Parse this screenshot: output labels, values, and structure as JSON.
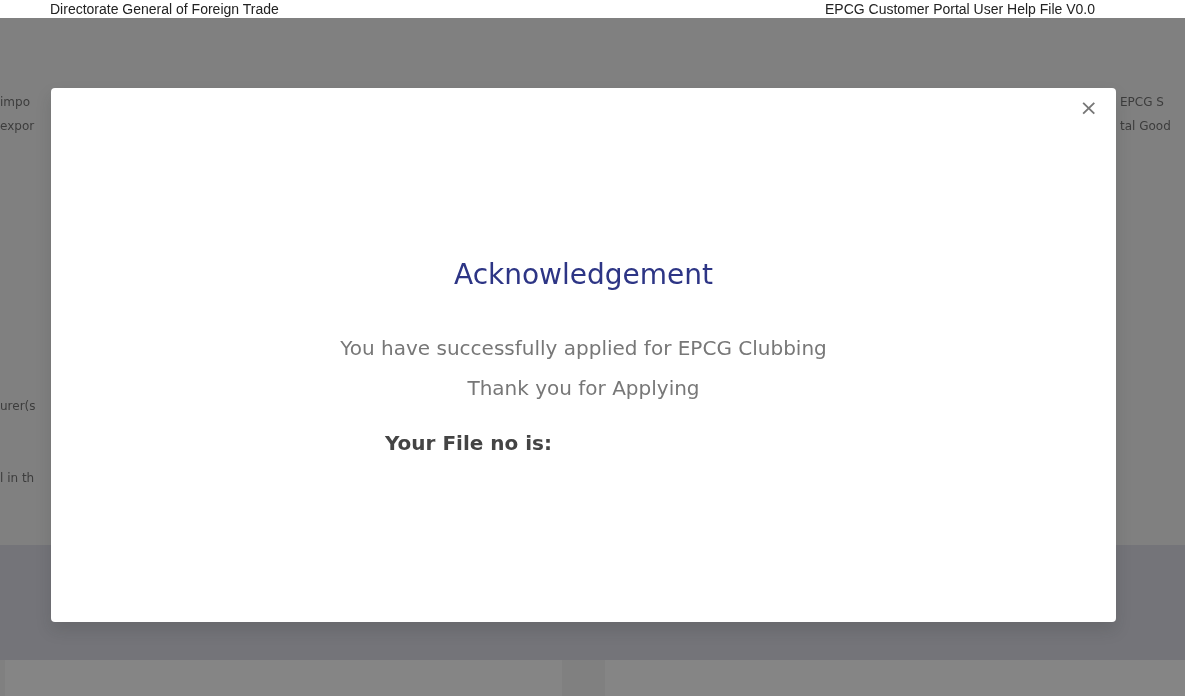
{
  "header": {
    "left": "Directorate General of Foreign Trade",
    "right": "EPCG Customer Portal User Help File V0.0"
  },
  "background": {
    "left_fragments": [
      "impo",
      "expor",
      "urer(s",
      "l in th"
    ],
    "right_fragments": [
      "EPCG S",
      "tal Good"
    ]
  },
  "modal": {
    "close": "×",
    "title": "Acknowledgement",
    "messages": [
      "You have successfully applied for EPCG Clubbing",
      "Thank you for Applying"
    ],
    "file_label": "Your File no is:"
  }
}
